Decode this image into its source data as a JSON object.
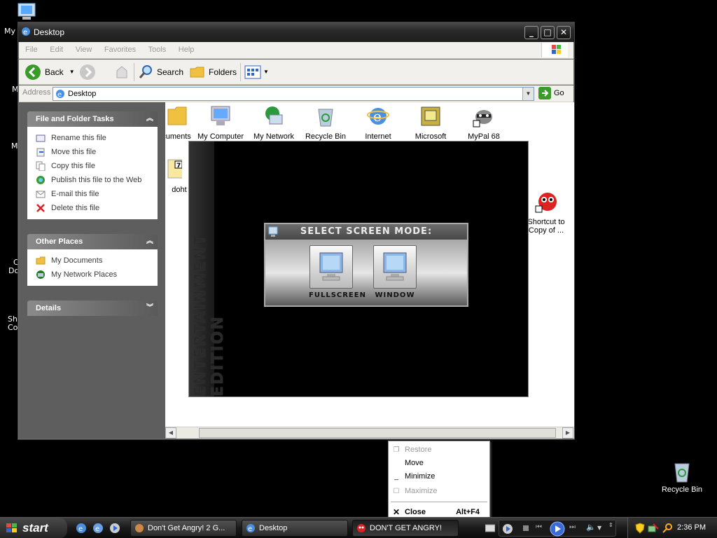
{
  "desktop_left_labels": [
    "My",
    "M",
    "M",
    "C",
    "Do",
    "Sh",
    "Co"
  ],
  "window": {
    "title": "Desktop",
    "menu": [
      "File",
      "Edit",
      "View",
      "Favorites",
      "Tools",
      "Help"
    ],
    "toolbar": {
      "back": "Back",
      "search": "Search",
      "folders": "Folders"
    },
    "address": {
      "label": "Address",
      "value": "Desktop",
      "go": "Go"
    }
  },
  "taskpane": {
    "file_tasks": {
      "title": "File and Folder Tasks",
      "items": [
        "Rename this file",
        "Move this file",
        "Copy this file",
        "Publish this file to the Web",
        "E-mail this file",
        "Delete this file"
      ]
    },
    "other_places": {
      "title": "Other Places",
      "items": [
        "My Documents",
        "My Network Places"
      ]
    },
    "details": {
      "title": "Details"
    }
  },
  "content": {
    "icons": [
      "cuments",
      "My Computer",
      "My Network",
      "Recycle Bin",
      "Internet",
      "Microsoft",
      "MyPal 68"
    ],
    "partial_icon": "doht",
    "shortcut_label": [
      "Shortcut to",
      "Copy of ..."
    ]
  },
  "game": {
    "ribbon_text": "ENTERTAINMENT EDITION",
    "dialog_title": "SELECT SCREEN MODE:",
    "fullscreen": "FULLSCREEN",
    "window": "WINDOW"
  },
  "context_menu": {
    "restore": "Restore",
    "move": "Move",
    "minimize": "Minimize",
    "maximize": "Maximize",
    "close": "Close",
    "close_shortcut": "Alt+F4"
  },
  "desktop_right": {
    "recycle_bin": "Recycle Bin"
  },
  "taskbar": {
    "start": "start",
    "tasks": [
      "Don't Get Angry! 2 G...",
      "Desktop",
      "DON'T GET ANGRY!"
    ],
    "clock": "2:36 PM"
  }
}
